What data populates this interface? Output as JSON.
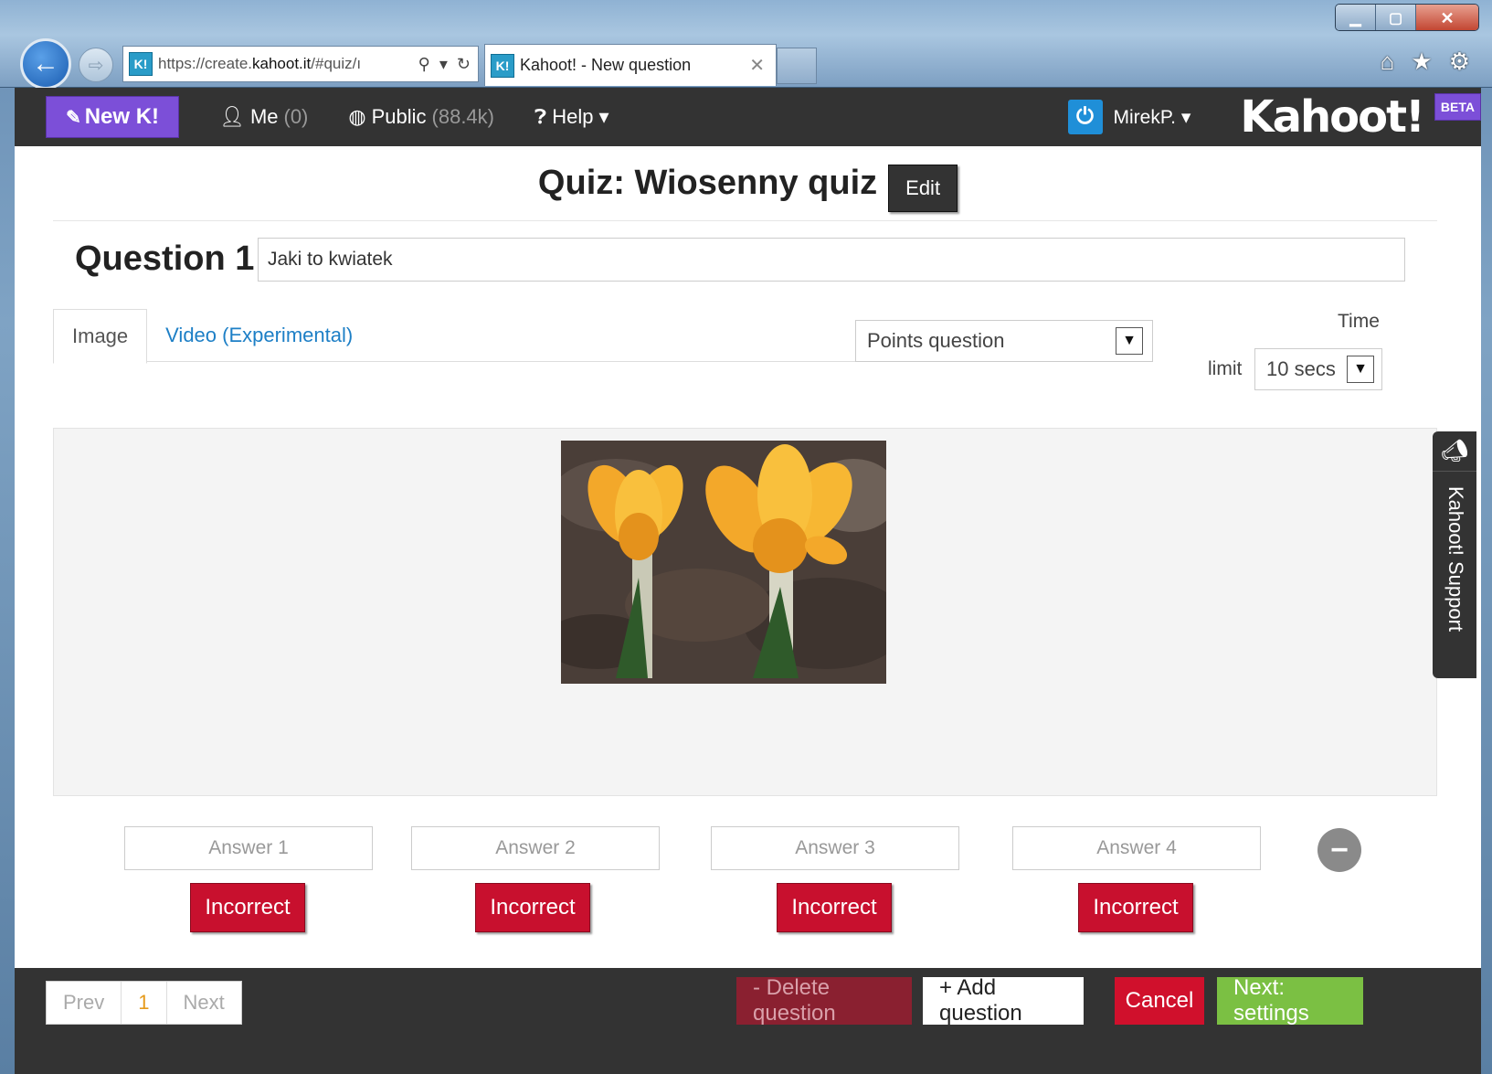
{
  "browser": {
    "url_prefix": "https://create.",
    "url_domain": "kahoot.it",
    "url_suffix": "/#quiz/ı",
    "tab_title": "Kahoot! - New question",
    "favicon_label": "K!"
  },
  "nav": {
    "new_label": "New K!",
    "me_label": "Me",
    "me_count": "(0)",
    "public_label": "Public",
    "public_count": "(88.4k)",
    "help_label": "Help",
    "username": "MirekP.",
    "logo": "Kahoot!",
    "beta": "BETA"
  },
  "quiz": {
    "title": "Quiz: Wiosenny quiz",
    "edit_label": "Edit"
  },
  "question": {
    "label": "Question 1",
    "text": "Jaki to kwiatek"
  },
  "media_tabs": [
    {
      "label": "Image",
      "active": true
    },
    {
      "label": "Video (Experimental)",
      "active": false
    }
  ],
  "question_type": {
    "selected": "Points question"
  },
  "time_limit": {
    "label_top": "Time",
    "label_bottom": "limit",
    "selected": "10 secs"
  },
  "support": {
    "label": "Kahoot! Support"
  },
  "answers": [
    {
      "placeholder": "Answer 1",
      "status": "Incorrect"
    },
    {
      "placeholder": "Answer 2",
      "status": "Incorrect"
    },
    {
      "placeholder": "Answer 3",
      "status": "Incorrect"
    },
    {
      "placeholder": "Answer 4",
      "status": "Incorrect"
    }
  ],
  "footer": {
    "prev": "Prev",
    "page": "1",
    "next": "Next",
    "delete": "- Delete question",
    "add": "+ Add question",
    "cancel": "Cancel",
    "next_settings": "Next: settings"
  },
  "colors": {
    "purple": "#7c4fd8",
    "dark": "#333333",
    "red": "#c8102e",
    "green": "#7bc043",
    "link": "#1d7fc6"
  },
  "icons": [
    "back-arrow-icon",
    "forward-arrow-icon",
    "search-icon",
    "refresh-icon",
    "home-icon",
    "star-icon",
    "gear-icon",
    "user-icon",
    "globe-icon",
    "question-icon",
    "power-icon",
    "megaphone-icon",
    "minus-icon",
    "pencil-icon"
  ]
}
